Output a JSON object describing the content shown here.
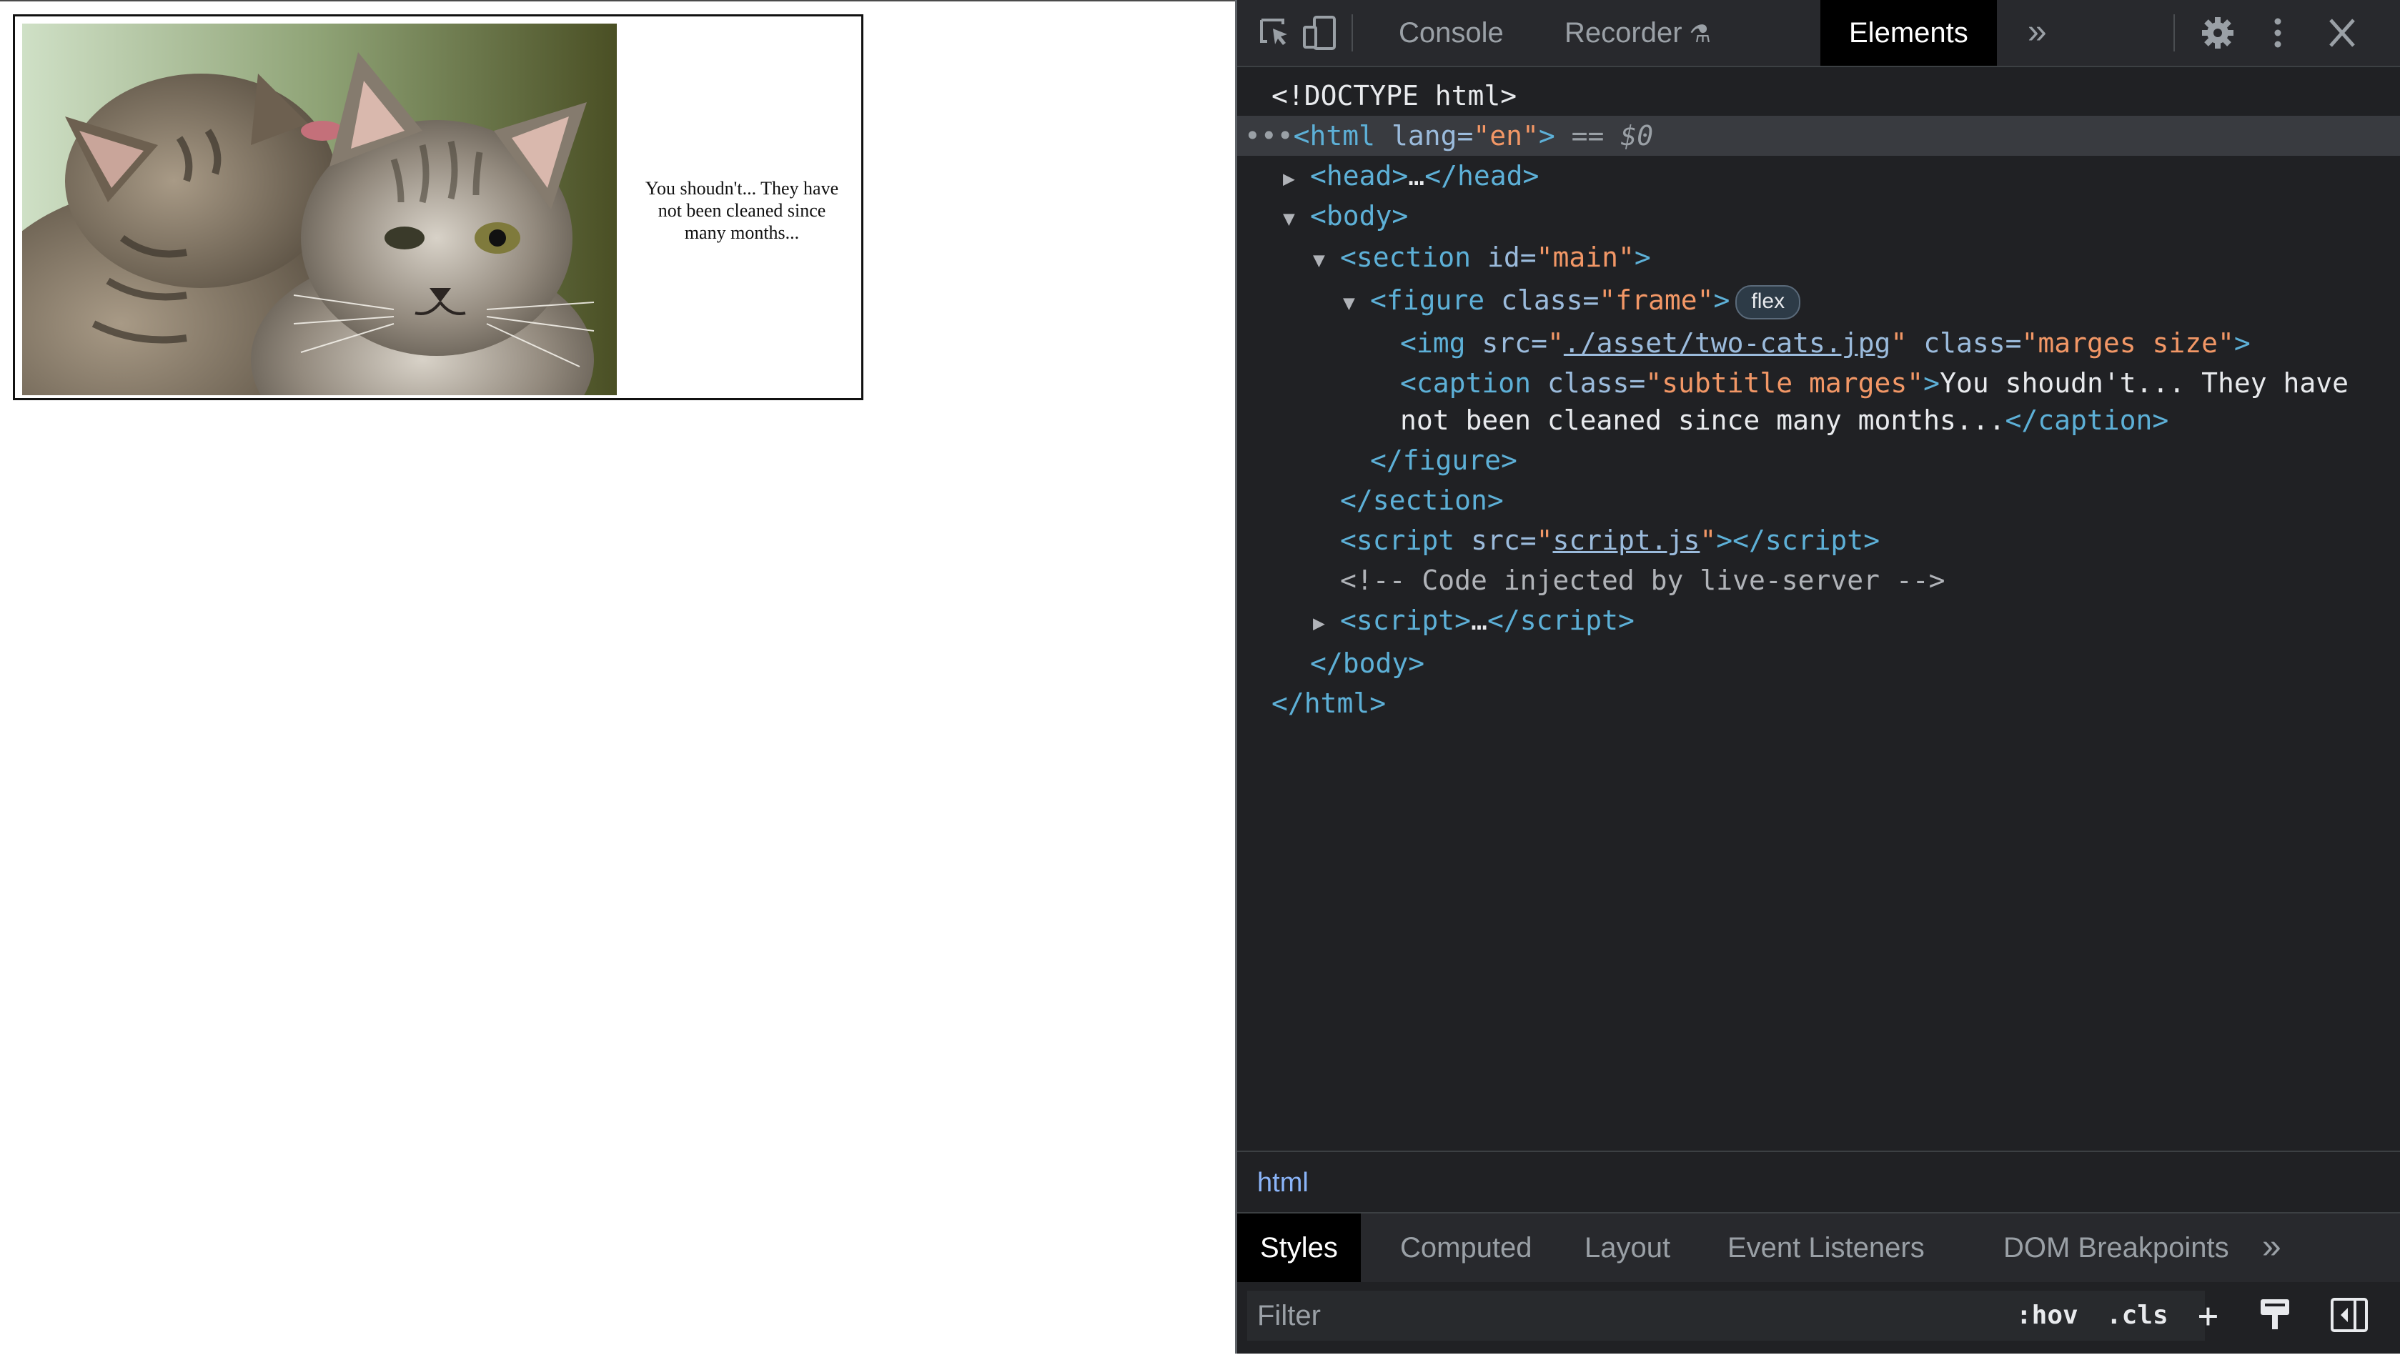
{
  "page": {
    "caption": "You shoudn't... They have not been cleaned since many months..."
  },
  "devtools": {
    "tabs": [
      "Console",
      "Recorder",
      "Elements"
    ],
    "active_tab": "Elements",
    "more_tabs_glyph": "»",
    "dom": {
      "doctype": "<!DOCTYPE html>",
      "html_tag": "html",
      "html_lang_attr": "lang",
      "html_lang_value": "en",
      "selected_marker": "== ",
      "selected_var": "$0",
      "head": "head",
      "head_ellipsis": "…",
      "body": "body",
      "section_tag": "section",
      "section_attr": "id",
      "section_value": "main",
      "figure_tag": "figure",
      "figure_attr": "class",
      "figure_value": "frame",
      "figure_badge": "flex",
      "img_tag": "img",
      "img_src_attr": "src",
      "img_src_value": "./asset/two-cats.jpg",
      "img_class_attr": "class",
      "img_class_value": "marges size",
      "caption_tag": "caption",
      "caption_class_attr": "class",
      "caption_class_value": "subtitle marges",
      "caption_text_1": "You shoudn't... They have",
      "caption_text_2": "not been cleaned since many months...",
      "script_tag": "script",
      "script_src_attr": "src",
      "script_src_value": "script.js",
      "comment": "<!-- Code injected by live-server -->",
      "script2_ellipsis": "…"
    },
    "breadcrumb": "html",
    "style_tabs": [
      "Styles",
      "Computed",
      "Layout",
      "Event Listeners",
      "DOM Breakpoints"
    ],
    "active_style_tab": "Styles",
    "filter_placeholder": "Filter",
    "hov_label": ":hov",
    "cls_label": ".cls",
    "add_label": "+"
  },
  "icons": [
    "inspect-element-icon",
    "device-toolbar-icon",
    "flask-icon",
    "more-tabs-icon",
    "settings-gear-icon",
    "kebab-menu-icon",
    "close-icon",
    "new-style-rule-icon",
    "computed-styles-toggle-icon",
    "sidebar-toggle-icon"
  ]
}
